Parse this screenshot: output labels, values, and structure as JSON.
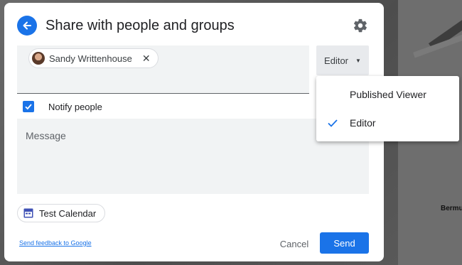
{
  "dialog": {
    "title": "Share with people and groups"
  },
  "people": {
    "chips": [
      {
        "name": "Sandy Writtenhouse"
      }
    ]
  },
  "role_button": {
    "label": "Editor"
  },
  "role_menu": {
    "options": [
      {
        "label": "Published Viewer",
        "selected": false
      },
      {
        "label": "Editor",
        "selected": true
      }
    ]
  },
  "notify": {
    "label": "Notify people",
    "checked": true
  },
  "message": {
    "placeholder": "Message",
    "value": ""
  },
  "calendar": {
    "label": "Test Calendar"
  },
  "footer": {
    "feedback_link": "Send feedback to Google",
    "cancel_label": "Cancel",
    "send_label": "Send"
  },
  "background": {
    "map_label": "Bermu"
  },
  "colors": {
    "accent": "#1a73e8",
    "field_bg": "#f1f3f4"
  }
}
